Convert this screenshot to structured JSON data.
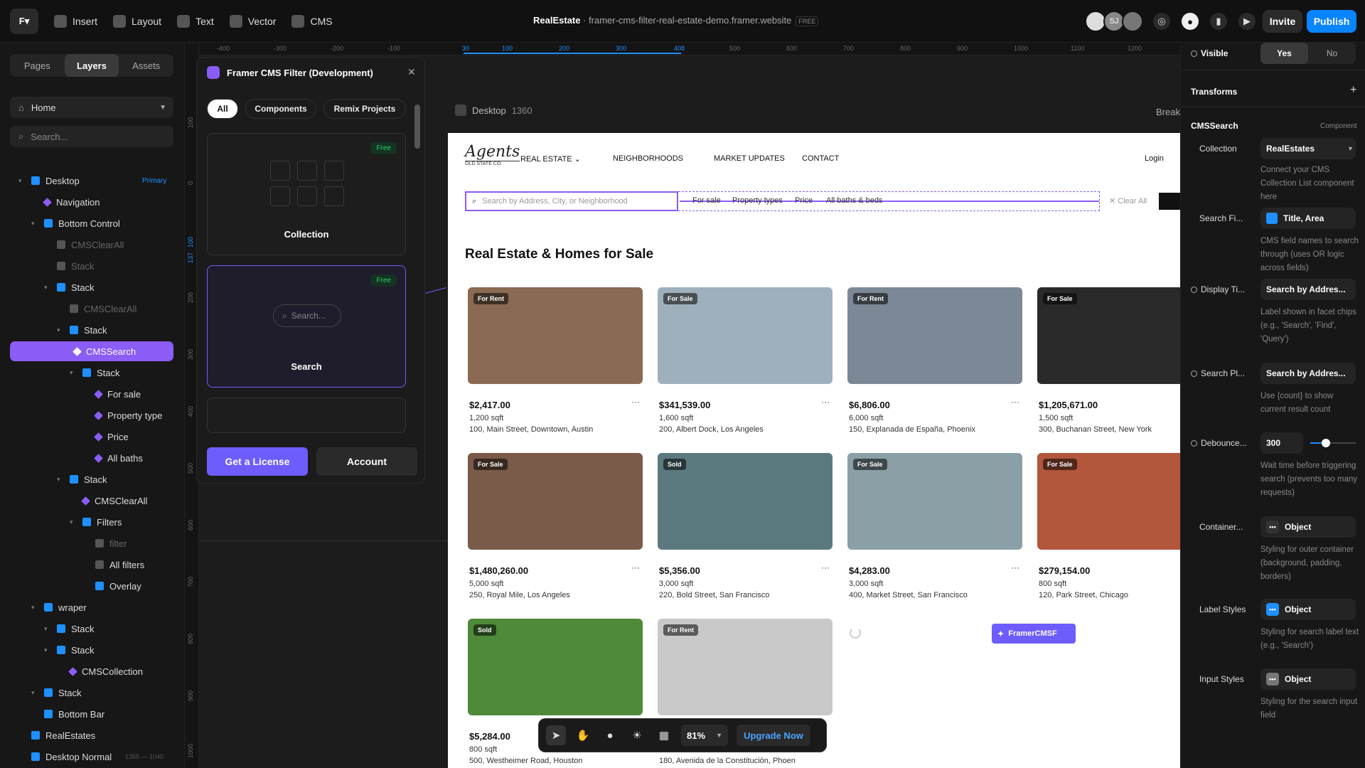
{
  "topbar": {
    "tools": [
      "Insert",
      "Layout",
      "Text",
      "Vector",
      "CMS"
    ],
    "site_name": "RealEstate",
    "site_url": "framer-cms-filter-real-estate-demo.framer.website",
    "plan_badge": "FREE",
    "avatar_initials": "SJ",
    "invite_label": "Invite",
    "publish_label": "Publish"
  },
  "left_panel": {
    "tabs": [
      "Pages",
      "Layers",
      "Assets"
    ],
    "page_selector": "Home",
    "search_placeholder": "Search...",
    "primary_badge": "Primary",
    "layers": [
      {
        "label": "Desktop",
        "indent": 0,
        "type": "frame"
      },
      {
        "label": "Navigation",
        "indent": 1,
        "type": "comp"
      },
      {
        "label": "Bottom Control",
        "indent": 1,
        "type": "frame"
      },
      {
        "label": "CMSClearAll",
        "indent": 2,
        "type": "dim"
      },
      {
        "label": "Stack",
        "indent": 2,
        "type": "dim"
      },
      {
        "label": "Stack",
        "indent": 2,
        "type": "frame"
      },
      {
        "label": "CMSClearAll",
        "indent": 3,
        "type": "dim"
      },
      {
        "label": "Stack",
        "indent": 3,
        "type": "frame"
      },
      {
        "label": "CMSSearch",
        "indent": 4,
        "type": "sel"
      },
      {
        "label": "Stack",
        "indent": 4,
        "type": "frame"
      },
      {
        "label": "For sale",
        "indent": 5,
        "type": "comp"
      },
      {
        "label": "Property type",
        "indent": 5,
        "type": "comp"
      },
      {
        "label": "Price",
        "indent": 5,
        "type": "comp"
      },
      {
        "label": "All baths",
        "indent": 5,
        "type": "comp"
      },
      {
        "label": "Stack",
        "indent": 3,
        "type": "frame"
      },
      {
        "label": "CMSClearAll",
        "indent": 4,
        "type": "comp"
      },
      {
        "label": "Filters",
        "indent": 4,
        "type": "frame"
      },
      {
        "label": "filter",
        "indent": 5,
        "type": "dim"
      },
      {
        "label": "All filters",
        "indent": 5,
        "type": "text"
      },
      {
        "label": "Overlay",
        "indent": 5,
        "type": "frame"
      },
      {
        "label": "wraper",
        "indent": 1,
        "type": "frame"
      },
      {
        "label": "Stack",
        "indent": 2,
        "type": "frame"
      },
      {
        "label": "Stack",
        "indent": 2,
        "type": "frame"
      },
      {
        "label": "CMSCollection",
        "indent": 3,
        "type": "comp"
      },
      {
        "label": "Stack",
        "indent": 1,
        "type": "frame"
      },
      {
        "label": "Bottom Bar",
        "indent": 1,
        "type": "frame"
      },
      {
        "label": "RealEstates",
        "indent": 0,
        "type": "frame"
      },
      {
        "label": "Desktop Normal",
        "indent": 0,
        "type": "frame"
      }
    ],
    "desktop_normal_dims": "1359 — 1040"
  },
  "rulers": {
    "horizontal": [
      "-400",
      "-300",
      "-200",
      "-100",
      "30",
      "100",
      "200",
      "300",
      "408",
      "500",
      "600",
      "700",
      "800",
      "900",
      "1000",
      "1100",
      "1200"
    ],
    "vertical": [
      "100",
      "0",
      "100",
      "137",
      "200",
      "300",
      "400",
      "500",
      "600",
      "700",
      "800",
      "900",
      "1000"
    ]
  },
  "plugin": {
    "title": "Framer CMS Filter (Development)",
    "filter_chips": [
      "All",
      "Components",
      "Remix Projects"
    ],
    "cards": [
      {
        "label": "Collection",
        "badge": "Free"
      },
      {
        "label": "Search",
        "badge": "Free",
        "search_placeholder": "Search..."
      }
    ],
    "license_button": "Get a License",
    "account_button": "Account"
  },
  "frame": {
    "name": "Desktop",
    "width": "1360",
    "breakpoint_label": "Break"
  },
  "site": {
    "logo_text": "Agents",
    "logo_sub": "OLD STATE CO.",
    "nav": [
      "REAL ESTATE",
      "NEIGHBORHOODS",
      "MARKET UPDATES",
      "CONTACT"
    ],
    "login": "Login",
    "search_placeholder": "Search by Address, City, or Neighborhood",
    "facets": [
      "For sale",
      "Property types",
      "Price",
      "All baths & beds"
    ],
    "clear_all": "Clear All",
    "heading": "Real Estate & Homes for Sale",
    "listings": [
      {
        "tag": "For Rent",
        "price": "$2,417.00",
        "sqft": "1,200 sqft",
        "address": "100, Main Street, Downtown, Austin",
        "color": "#8a6a52"
      },
      {
        "tag": "For Sale",
        "price": "$341,539.00",
        "sqft": "1,600 sqft",
        "address": "200, Albert Dock, Los Angeles",
        "color": "#9fb0bd"
      },
      {
        "tag": "For Rent",
        "price": "$6,806.00",
        "sqft": "6,000 sqft",
        "address": "150, Explanada de España, Phoenix",
        "color": "#7c8896"
      },
      {
        "tag": "For Sale",
        "price": "$1,205,671.00",
        "sqft": "1,500 sqft",
        "address": "300, Buchanan Street, New York",
        "color": "#2a2a2a"
      },
      {
        "tag": "For Sale",
        "price": "$1,480,260.00",
        "sqft": "5,000 sqft",
        "address": "250, Royal Mile, Los Angeles",
        "color": "#7a5a48"
      },
      {
        "tag": "Sold",
        "price": "$5,356.00",
        "sqft": "3,000 sqft",
        "address": "220, Bold Street, San Francisco",
        "color": "#5b7a80"
      },
      {
        "tag": "For Sale",
        "price": "$4,283.00",
        "sqft": "3,000 sqft",
        "address": "400, Market Street, San Francisco",
        "color": "#8aa0a6"
      },
      {
        "tag": "For Sale",
        "price": "$279,154.00",
        "sqft": "800 sqft",
        "address": "120, Park Street, Chicago",
        "color": "#b2563c"
      },
      {
        "tag": "Sold",
        "price": "$5,284.00",
        "sqft": "800 sqft",
        "address": "500, Westheimer Road, Houston",
        "color": "#4f8a3a"
      },
      {
        "tag": "For Rent",
        "price": "",
        "sqft": "",
        "address": "180, Avenida de la Constitución, Phoen",
        "color": "#c9c9c9"
      }
    ],
    "framer_badge": "FramerCMSF"
  },
  "bottom_toolbar": {
    "zoom": "81%",
    "upgrade": "Upgrade Now"
  },
  "right_panel": {
    "visible_label": "Visible",
    "visible_yes": "Yes",
    "visible_no": "No",
    "transforms": "Transforms",
    "component_name": "CMSSearch",
    "component_tag": "Component",
    "collection_label": "Collection",
    "collection_value": "RealEstates",
    "collection_help": "Connect your CMS Collection List component here",
    "search_fields_label": "Search Fi...",
    "search_fields_value": "Title, Area",
    "search_fields_help": "CMS field names to search through (uses OR logic across fields)",
    "display_title_label": "Display Ti...",
    "display_title_value": "Search by Addres...",
    "display_title_help": "Label shown in facet chips (e.g., 'Search', 'Find', 'Query')",
    "search_placeholder_label": "Search Pl...",
    "search_placeholder_value": "Search by Addres...",
    "search_placeholder_help": "Use {count} to show current result count",
    "debounce_label": "Debounce...",
    "debounce_value": "300",
    "debounce_help": "Wait time before triggering search (prevents too many requests)",
    "container_label": "Container...",
    "container_value": "Object",
    "container_help": "Styling for outer container (background, padding, borders)",
    "label_styles_label": "Label Styles",
    "label_styles_value": "Object",
    "label_styles_help": "Styling for search label text (e.g., 'Search')",
    "input_styles_label": "Input Styles",
    "input_styles_value": "Object",
    "input_styles_help": "Styling for the search input field"
  }
}
